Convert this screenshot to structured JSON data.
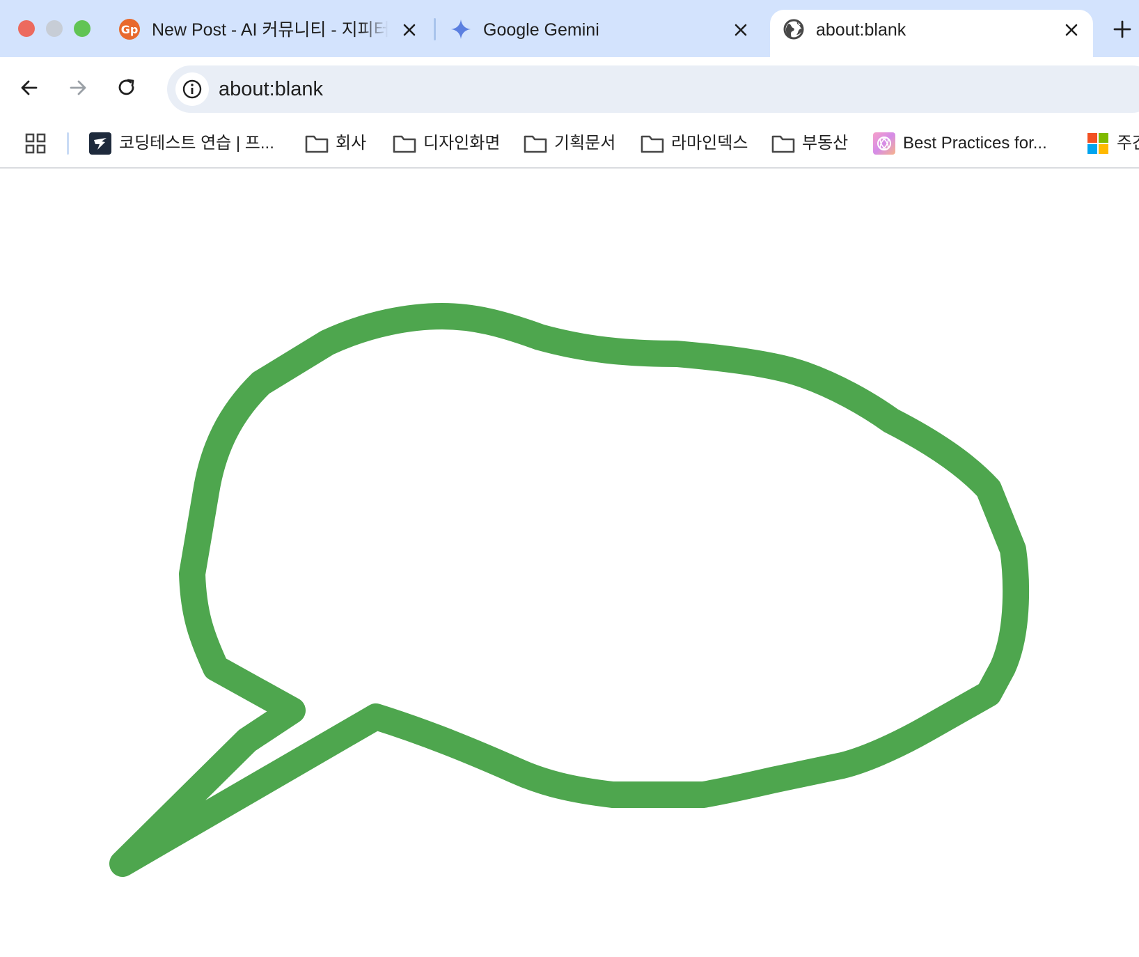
{
  "window": {
    "controls": [
      "close",
      "minimize",
      "zoom"
    ]
  },
  "tabs": [
    {
      "title": "New Post - AI 커뮤니티 - 지피터",
      "favicon": "gpters-logo-icon",
      "active": false
    },
    {
      "title": "Google Gemini",
      "favicon": "gemini-sparkle-icon",
      "active": false
    },
    {
      "title": "about:blank",
      "favicon": "globe-icon",
      "active": true
    }
  ],
  "toolbar": {
    "url": "about:blank"
  },
  "bookmarks": [
    {
      "label": "코딩테스트 연습 | 프...",
      "icon": "programmers-icon"
    },
    {
      "label": "회사",
      "icon": "folder-icon"
    },
    {
      "label": "디자인화면",
      "icon": "folder-icon"
    },
    {
      "label": "기획문서",
      "icon": "folder-icon"
    },
    {
      "label": "라마인덱스",
      "icon": "folder-icon"
    },
    {
      "label": "부동산",
      "icon": "folder-icon"
    },
    {
      "label": "Best Practices for...",
      "icon": "openai-logo-icon"
    },
    {
      "label": "주간",
      "icon": "microsoft-logo-icon"
    }
  ],
  "colors": {
    "tabstrip": "#d3e3fd",
    "omnibox": "#e9eef6",
    "stroke": "#4ea64e"
  },
  "canvas": {
    "drawing": "speech-bubble-stroke"
  }
}
